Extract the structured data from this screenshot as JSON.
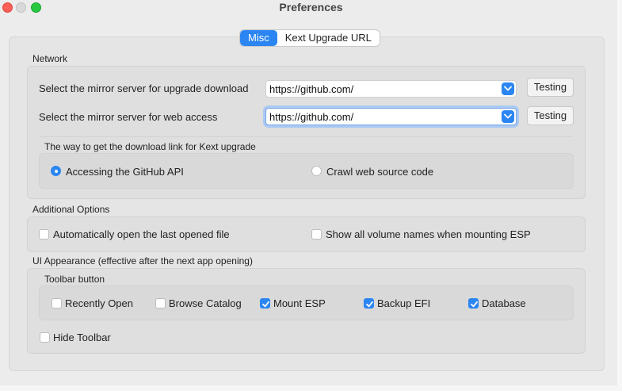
{
  "window": {
    "title": "Preferences"
  },
  "tabs": [
    {
      "label": "Misc",
      "active": true
    },
    {
      "label": "Kext Upgrade URL",
      "active": false
    }
  ],
  "network": {
    "section_label": "Network",
    "upgrade_mirror": {
      "label": "Select the mirror server for upgrade download",
      "value": "https://github.com/",
      "button": "Testing"
    },
    "web_mirror": {
      "label": "Select the mirror server for web access",
      "value": "https://github.com/",
      "button": "Testing"
    },
    "kext_link": {
      "label": "The way to get the download link for Kext upgrade",
      "options": [
        {
          "label": "Accessing the GitHub API",
          "selected": true
        },
        {
          "label": "Crawl web source code",
          "selected": false
        }
      ]
    }
  },
  "additional": {
    "section_label": "Additional Options",
    "options": [
      {
        "label": "Automatically open the last opened file",
        "checked": false
      },
      {
        "label": "Show all volume names when mounting ESP",
        "checked": false
      }
    ]
  },
  "appearance": {
    "section_label": "UI Appearance (effective after the next app opening)",
    "toolbar_label": "Toolbar button",
    "toolbar_buttons": [
      {
        "label": "Recently Open",
        "checked": false
      },
      {
        "label": "Browse Catalog",
        "checked": false
      },
      {
        "label": "Mount ESP",
        "checked": true
      },
      {
        "label": "Backup EFI",
        "checked": true
      },
      {
        "label": "Database",
        "checked": true
      }
    ],
    "hide_toolbar": {
      "label": "Hide Toolbar",
      "checked": false
    }
  },
  "colors": {
    "accent": "#2b86f3",
    "close": "#ff5f57",
    "maximize": "#28c840"
  },
  "icons": {
    "combo_caret": "chevron-down-icon",
    "checkmark": "checkmark-icon"
  }
}
